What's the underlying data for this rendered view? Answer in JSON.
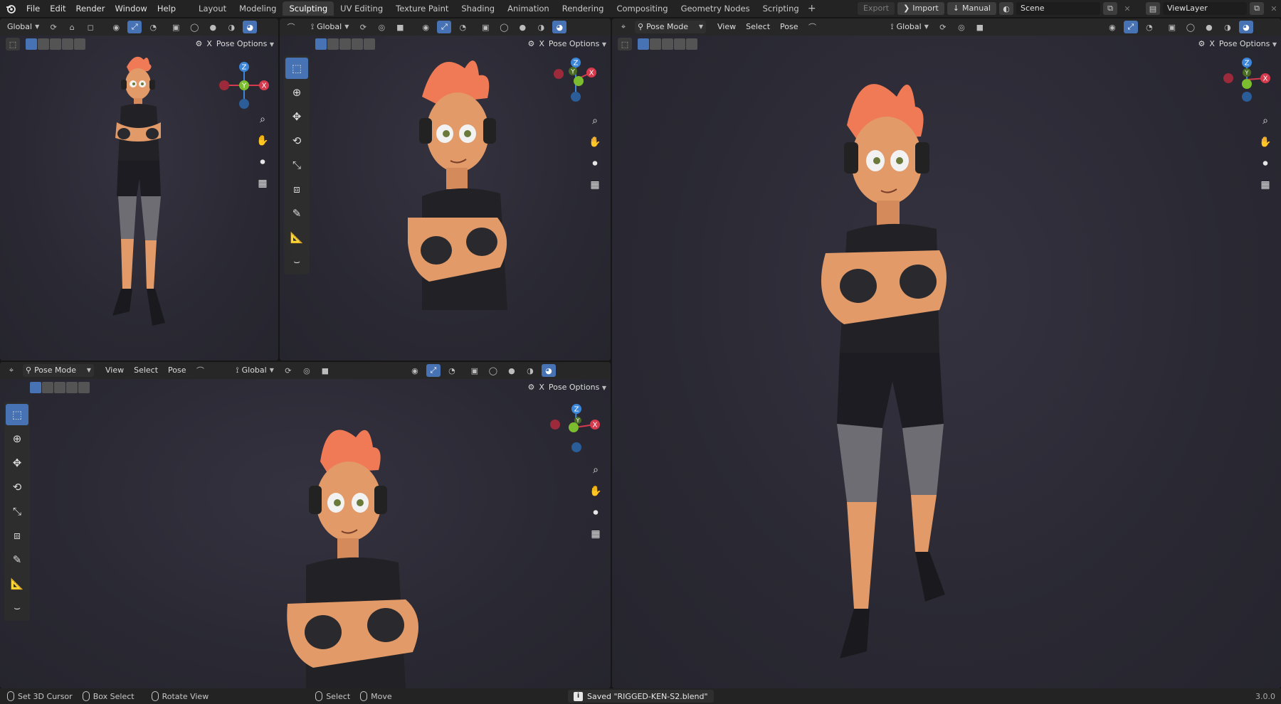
{
  "menu": [
    "File",
    "Edit",
    "Render",
    "Window",
    "Help"
  ],
  "workspaces": [
    {
      "label": "Layout",
      "active": false
    },
    {
      "label": "Modeling",
      "active": false
    },
    {
      "label": "Sculpting",
      "active": true
    },
    {
      "label": "UV Editing",
      "active": false
    },
    {
      "label": "Texture Paint",
      "active": false
    },
    {
      "label": "Shading",
      "active": false
    },
    {
      "label": "Animation",
      "active": false
    },
    {
      "label": "Rendering",
      "active": false
    },
    {
      "label": "Compositing",
      "active": false
    },
    {
      "label": "Geometry Nodes",
      "active": false
    },
    {
      "label": "Scripting",
      "active": false
    }
  ],
  "top_right": {
    "export": "Export",
    "import": "Import",
    "manual": "Manual",
    "scene": "Scene",
    "view_layer": "ViewLayer"
  },
  "viewport": {
    "pose_mode": "Pose Mode",
    "view": "View",
    "select": "Select",
    "pose": "Pose",
    "orientation": "Global",
    "pose_options": "Pose Options",
    "x_label": "X"
  },
  "gizmo": {
    "x": "X",
    "y": "Y",
    "z": "Z"
  },
  "status": {
    "set_cursor": "Set 3D Cursor",
    "box_select": "Box Select",
    "rotate_view": "Rotate View",
    "select": "Select",
    "move": "Move",
    "saved": "Saved \"RIGGED-KEN-S2.blend\"",
    "version": "3.0.0"
  },
  "colors": {
    "accent": "#4772b3",
    "axis_x": "#d63a4d",
    "axis_y": "#7bbd2f",
    "axis_z": "#3b86d8",
    "hair": "#f07a55",
    "skin": "#e29a68"
  }
}
